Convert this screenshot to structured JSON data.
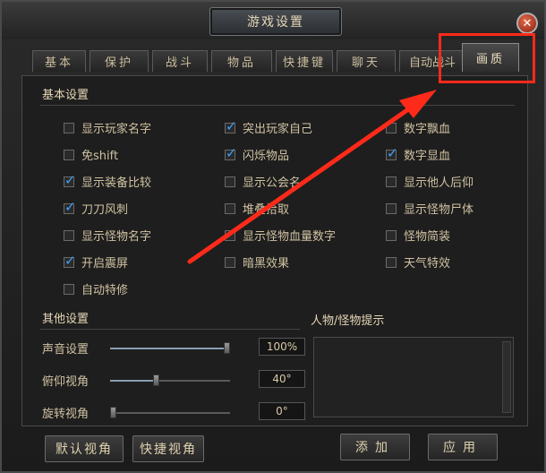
{
  "window": {
    "title": "游戏设置",
    "close_symbol": "✕"
  },
  "tabs": [
    {
      "label": "基本"
    },
    {
      "label": "保护"
    },
    {
      "label": "战斗"
    },
    {
      "label": "物品"
    },
    {
      "label": "快捷键"
    },
    {
      "label": "聊天"
    },
    {
      "label": "自动战斗"
    },
    {
      "label": "画质",
      "active": true
    }
  ],
  "basic": {
    "title": "基本设置",
    "options": [
      {
        "label": "显示玩家名字",
        "checked": false
      },
      {
        "label": "免shift",
        "checked": false
      },
      {
        "label": "显示装备比较",
        "checked": true
      },
      {
        "label": "刀刀风刺",
        "checked": true
      },
      {
        "label": "显示怪物名字",
        "checked": false
      },
      {
        "label": "开启震屏",
        "checked": true
      },
      {
        "label": "自动特修",
        "checked": false
      },
      {
        "label": "突出玩家自己",
        "checked": true
      },
      {
        "label": "闪烁物品",
        "checked": true
      },
      {
        "label": "显示公会名",
        "checked": false
      },
      {
        "label": "堆叠拾取",
        "checked": false
      },
      {
        "label": "显示怪物血量数字",
        "checked": true
      },
      {
        "label": "暗黑效果",
        "checked": false
      },
      {
        "label": "数字飘血",
        "checked": false
      },
      {
        "label": "数字显血",
        "checked": true
      },
      {
        "label": "显示他人后仰",
        "checked": false
      },
      {
        "label": "显示怪物尸体",
        "checked": false
      },
      {
        "label": "怪物简装",
        "checked": false
      },
      {
        "label": "天气特效",
        "checked": false
      }
    ]
  },
  "other": {
    "title": "其他设置",
    "sliders": [
      {
        "label": "声音设置",
        "value": "100%",
        "level": 1.0
      },
      {
        "label": "俯仰视角",
        "value": "40°",
        "level": 0.38
      },
      {
        "label": "旋转视角",
        "value": "0°",
        "level": 0.0
      }
    ]
  },
  "hint": {
    "title": "人物/怪物提示"
  },
  "buttons": {
    "default_view": "默认视角",
    "quick_view": "快捷视角",
    "add": "添加",
    "apply": "应用"
  },
  "annotation": {
    "highlight_color": "#ff2a1a"
  }
}
